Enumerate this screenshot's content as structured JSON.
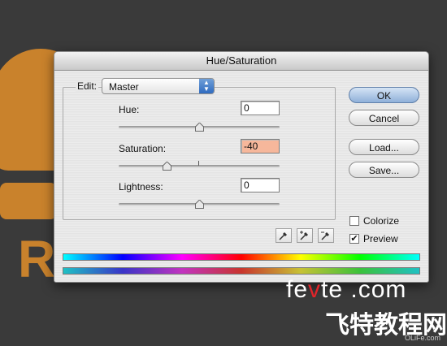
{
  "dialog": {
    "title": "Hue/Saturation",
    "edit": {
      "label": "Edit:",
      "value": "Master"
    },
    "hue": {
      "label": "Hue:",
      "value": "0",
      "slider_fraction": 0.5
    },
    "saturation": {
      "label": "Saturation:",
      "value": "-40",
      "slider_fraction": 0.3
    },
    "lightness": {
      "label": "Lightness:",
      "value": "0",
      "slider_fraction": 0.5
    },
    "buttons": {
      "ok": "OK",
      "cancel": "Cancel",
      "load": "Load...",
      "save": "Save..."
    },
    "colorize": {
      "label": "Colorize",
      "checked": false
    },
    "preview": {
      "label": "Preview",
      "checked": true
    }
  },
  "watermark": {
    "fevte_pre": "fe",
    "fevte_v": "v",
    "fevte_post": "te .com",
    "chinese": "飞特教程网",
    "olife": "OLiFe.com"
  },
  "colors": {
    "saturation_field": "#f6b79b",
    "default_button": "#8fb0d9",
    "background_artwork": "#c9822c"
  }
}
